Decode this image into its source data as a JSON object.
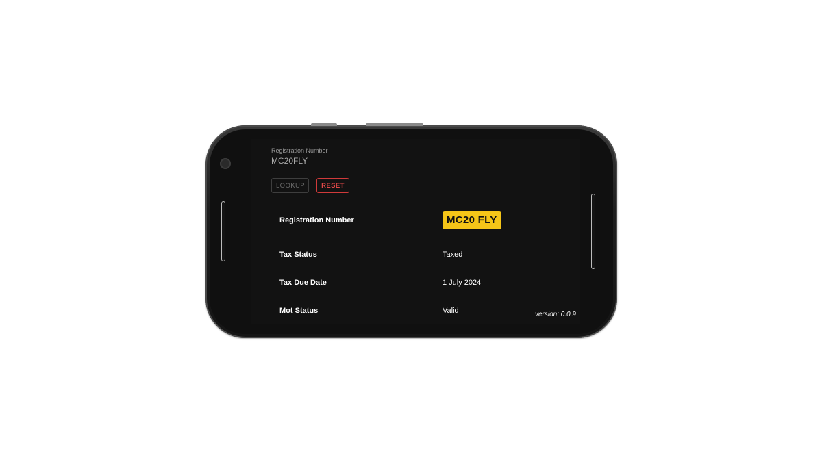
{
  "form": {
    "field_label": "Registration Number",
    "field_value": "MC20FLY",
    "lookup_label": "LOOKUP",
    "reset_label": "RESET"
  },
  "results": {
    "rows": [
      {
        "label": "Registration Number",
        "value": "MC20 FLY"
      },
      {
        "label": "Tax Status",
        "value": "Taxed"
      },
      {
        "label": "Tax Due Date",
        "value": "1 July 2024"
      },
      {
        "label": "Mot Status",
        "value": "Valid"
      }
    ]
  },
  "footer": {
    "version": "version: 0.0.9"
  },
  "colors": {
    "plate_background": "#f5c518",
    "reset_accent": "#e04848",
    "screen_background": "#121212"
  }
}
